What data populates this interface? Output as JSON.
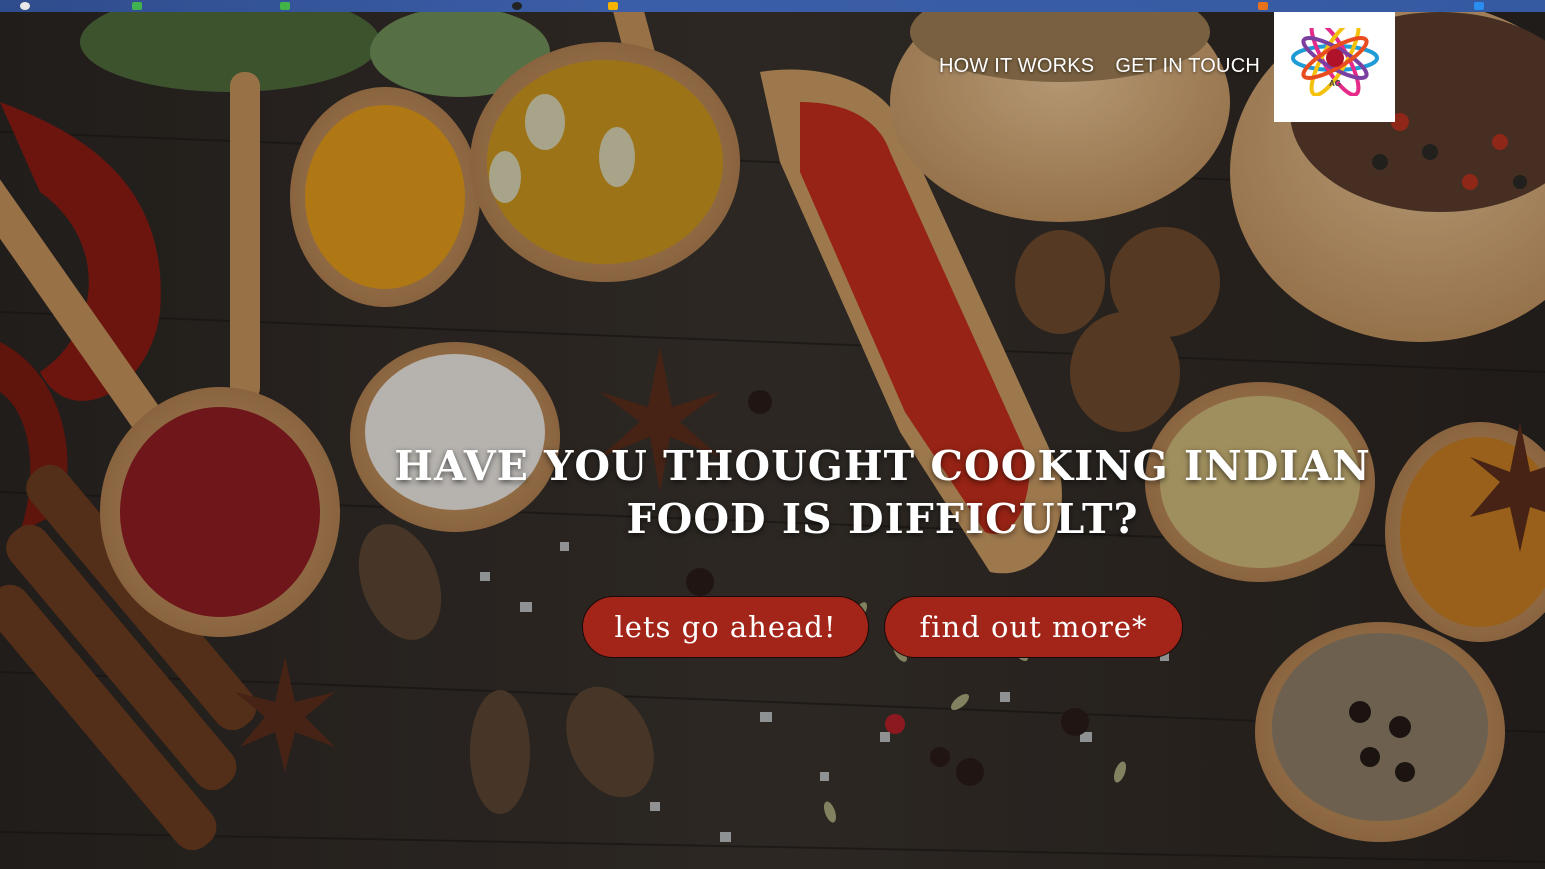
{
  "nav": {
    "items": [
      {
        "label": "HOW IT WORKS"
      },
      {
        "label": "GET IN TOUCH"
      }
    ]
  },
  "logo": {
    "icon": "flower-logo-icon",
    "text": "AG"
  },
  "hero": {
    "headline": "HAVE YOU THOUGHT COOKING INDIAN FOOD IS DIFFICULT?",
    "background": "spices-photo"
  },
  "cta": {
    "primary_label": "lets go ahead!",
    "secondary_label": "find out more*"
  },
  "colors": {
    "button_bg": "#a3251a",
    "nav_text": "#ffffff",
    "taskbar": "#365aa2"
  }
}
